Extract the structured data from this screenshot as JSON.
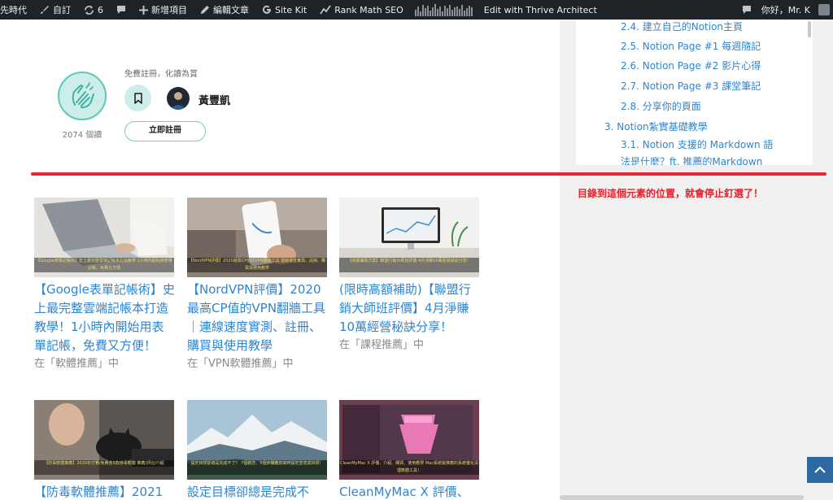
{
  "adminbar": {
    "site_name": "先時代",
    "customize": "自訂",
    "updates_count": "6",
    "new_item": "新增項目",
    "edit_post": "編輯文章",
    "site_kit": "Site Kit",
    "rank_math": "Rank Math SEO",
    "thrive": "Edit with Thrive Architect",
    "greeting": "你好，Mr. K"
  },
  "author": {
    "reads": "2074 個讀",
    "free_text": "免費註冊，化讀為賞",
    "name": "黃豐凱",
    "signup_label": "立即註冊"
  },
  "posts": [
    {
      "banner": "【Google表單記帳術】史上最完整雲端記帳本打造教學 1小時內開始用表單記帳，免費又方便",
      "title": "【Google表單記帳術】史上最完整雲端記帳本打造教學！1小時內開始用表單記帳，免費又方便！",
      "category": "在「軟體推薦」中"
    },
    {
      "banner": "【NordVPN評價】2020最高CP值的VPN翻牆工具 連線速度實測、註冊、購買與使用教學",
      "title": "【NordVPN評價】2020最高CP值的VPN翻牆工具｜連線速度實測、註冊、購買與使用教學",
      "category": "在「VPN軟體推薦」中"
    },
    {
      "banner": "【高額補助方案】聯盟行銷大師班評價 4月淨賺10萬經營祕訣分享！",
      "title": "(限時高額補助)【聯盟行銷大師班評價】4月淨賺10萬經營秘訣分享！",
      "category": "在「課程推薦」中"
    },
    {
      "banner": "【防毒軟體推薦】2020年付費/免費各5款排毒軟體 推薦/評比/介紹",
      "title": "【防毒軟體推薦】2021",
      "category": ""
    },
    {
      "banner": "設定目標卻總是完成不了？ 7個觀念、5個步驟教你如何設定並達成目標！",
      "title": "設定目標卻總是完成不",
      "category": ""
    },
    {
      "banner": "CleanMyMac X 評價、介紹、購買、使用教學 Mac系統最推薦的系統優化清理軟體工具！",
      "title": "CleanMyMac X 評價、介",
      "category": ""
    }
  ],
  "toc": [
    "2.4. 建立自己的Notion主頁",
    "2.5. Notion Page #1 每週隨記",
    "2.6. Notion Page #2 影片心得",
    "2.7. Notion Page #3 課堂筆記",
    "2.8. 分享你的頁面",
    "3. Notion紮實基礎教學",
    "3.1. Notion 支援的 Markdown 語",
    "法是什麼？ft. 推薦的Markdown"
  ],
  "annotation": "目錄到這個元素的位置，就會停止釘選了！",
  "colors": {
    "link": "#2f84cf",
    "accent": "#5ec8b6",
    "marker": "#ea2433",
    "adminbar": "#1d2327"
  },
  "icons": [
    "wordpress-icon",
    "brush-icon",
    "refresh-icon",
    "comment-icon",
    "plus-icon",
    "pencil-icon",
    "google-g-icon",
    "rank-math-icon",
    "bookmark-icon",
    "clapping-hands-icon",
    "arrow-up-icon"
  ]
}
